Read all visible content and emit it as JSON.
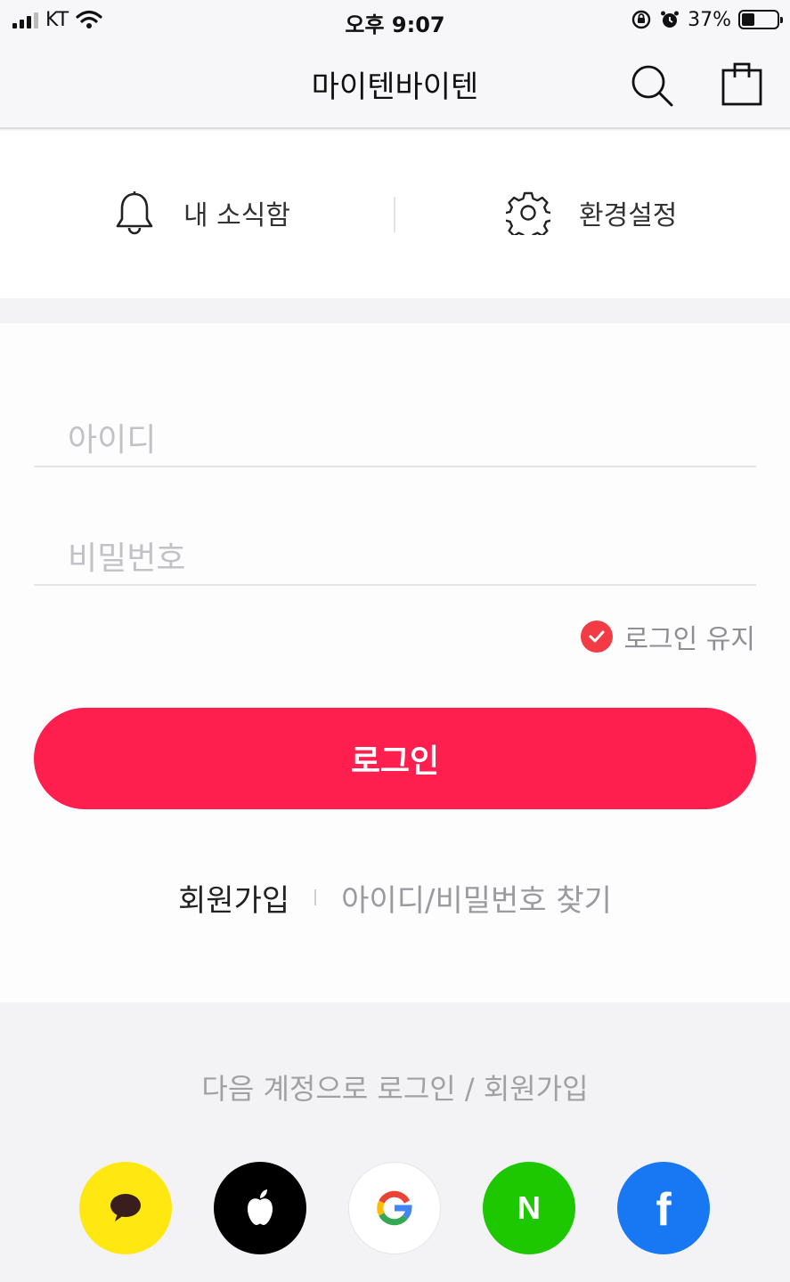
{
  "status_bar": {
    "carrier": "KT",
    "time": "오후 9:07",
    "battery": "37%",
    "battery_level": 0.37
  },
  "header": {
    "title": "마이텐바이텐"
  },
  "shortcuts": {
    "notifications_label": "내 소식함",
    "settings_label": "환경설정"
  },
  "login": {
    "id_placeholder": "아이디",
    "password_placeholder": "비밀번호",
    "keep_logged_in_label": "로그인 유지",
    "keep_logged_in_checked": true,
    "submit_label": "로그인",
    "signup_link": "회원가입",
    "find_account_link": "아이디/비밀번호 찾기"
  },
  "social": {
    "title": "다음 계정으로 로그인 / 회원가입",
    "providers": [
      {
        "name": "kakao",
        "color": "#FFE812"
      },
      {
        "name": "apple",
        "color": "#000000"
      },
      {
        "name": "google",
        "color": "#FFFFFF"
      },
      {
        "name": "naver",
        "color": "#1EC800",
        "letter": "N"
      },
      {
        "name": "facebook",
        "color": "#1877F2",
        "letter": "f"
      }
    ]
  },
  "colors": {
    "accent": "#FF1F4E",
    "check": "#F33B45"
  }
}
